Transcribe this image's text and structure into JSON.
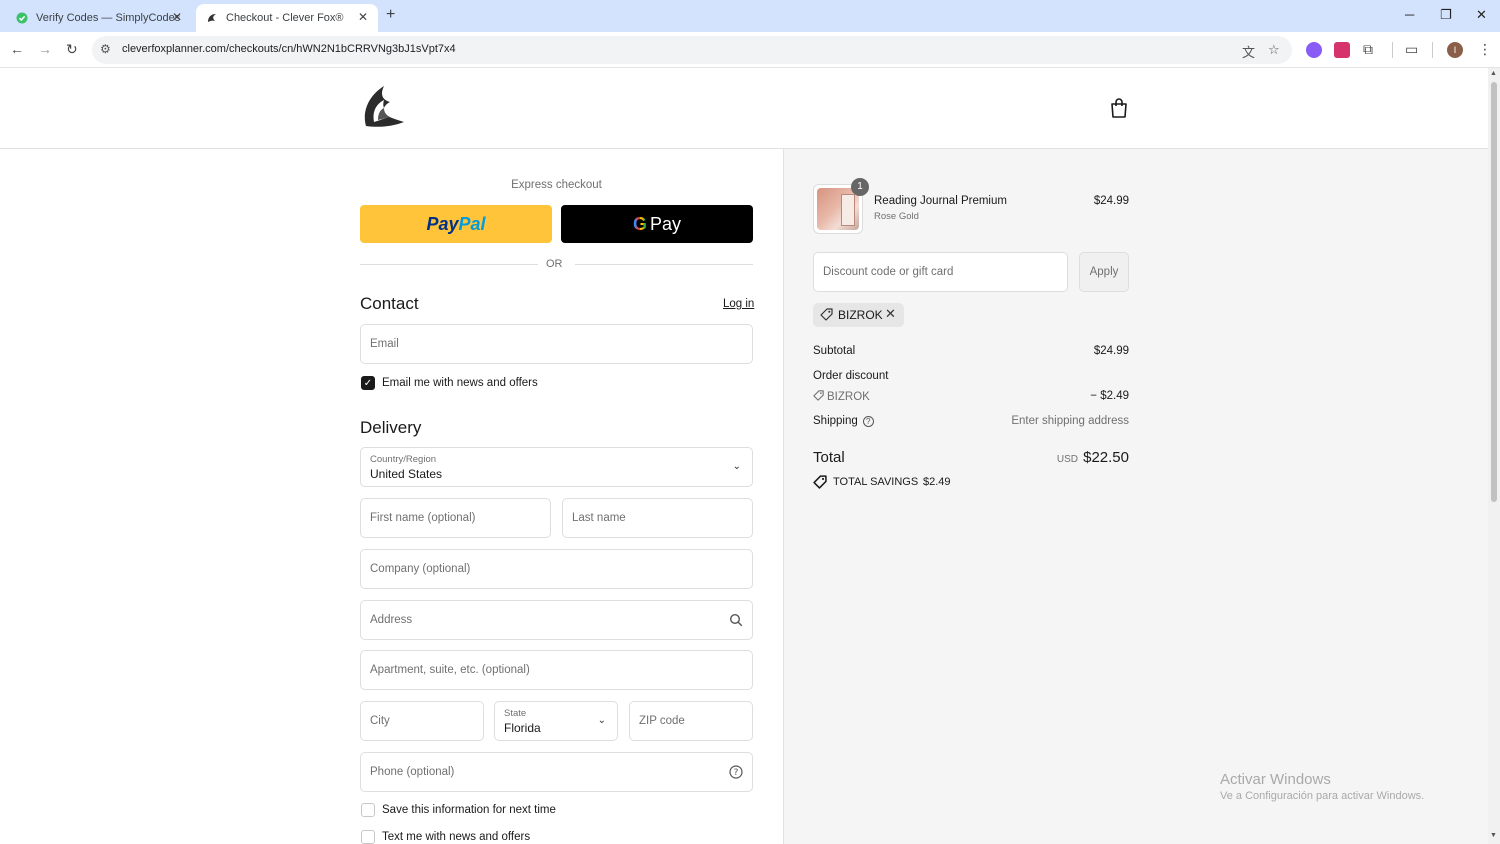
{
  "browser": {
    "tabs": [
      {
        "title": "Verify Codes — SimplyCodes",
        "active": false
      },
      {
        "title": "Checkout - Clever Fox®",
        "active": true
      }
    ],
    "new_tab_icon": "plus-icon",
    "url": "cleverfoxplanner.com/checkouts/cn/hWN2N1bCRRVNg3bJ1sVpt7x4",
    "profile_initial": "I"
  },
  "express_checkout": {
    "label": "Express checkout",
    "paypal": {
      "part1": "Pay",
      "part2": "Pal"
    },
    "gpay": {
      "g": "G",
      "label": "Pay"
    },
    "or_text": "OR"
  },
  "contact": {
    "title": "Contact",
    "login_link": "Log in",
    "email_placeholder": "Email",
    "news_checkbox_label": "Email me with news and offers",
    "news_checked": true
  },
  "delivery": {
    "title": "Delivery",
    "country_label": "Country/Region",
    "country_value": "United States",
    "first_name_placeholder": "First name (optional)",
    "last_name_placeholder": "Last name",
    "company_placeholder": "Company (optional)",
    "address_placeholder": "Address",
    "apartment_placeholder": "Apartment, suite, etc. (optional)",
    "city_placeholder": "City",
    "state_label": "State",
    "state_value": "Florida",
    "zip_placeholder": "ZIP code",
    "phone_placeholder": "Phone (optional)",
    "save_info_label": "Save this information for next time",
    "text_me_label": "Text me with news and offers"
  },
  "summary": {
    "product": {
      "quantity": "1",
      "name": "Reading Journal Premium",
      "variant": "Rose Gold",
      "price": "$24.99"
    },
    "discount_placeholder": "Discount code or gift card",
    "apply_label": "Apply",
    "applied_code": "BIZROK",
    "subtotal_label": "Subtotal",
    "subtotal_value": "$24.99",
    "order_discount_label": "Order discount",
    "discount_code": "BIZROK",
    "discount_value": "− $2.49",
    "shipping_label": "Shipping",
    "shipping_value": "Enter shipping address",
    "total_label": "Total",
    "total_currency": "USD",
    "total_value": "$22.50",
    "savings_label": "TOTAL SAVINGS",
    "savings_value": "$2.49"
  },
  "os_watermark": {
    "line1": "Activar Windows",
    "line2": "Ve a Configuración para activar Windows."
  }
}
